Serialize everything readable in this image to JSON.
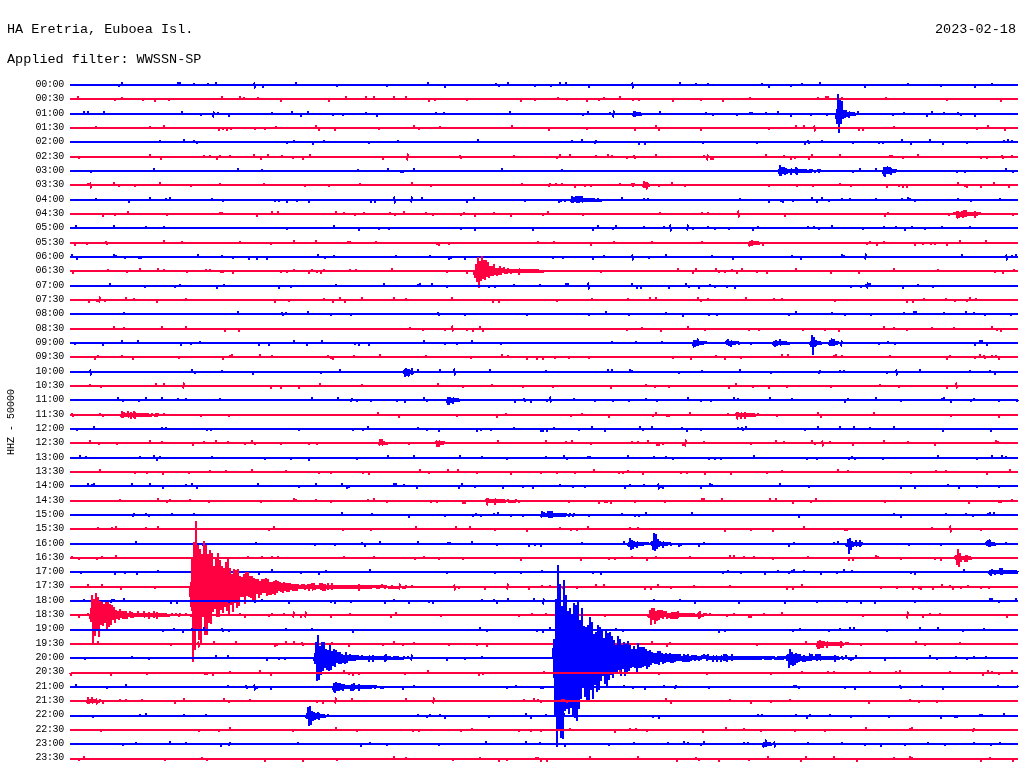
{
  "header": {
    "station": "HA Eretria, Euboea Isl.",
    "date": "2023-02-18"
  },
  "filter": "Applied filter: WWSSN-SP",
  "channel_label": "HHZ - 50000",
  "traces": [
    {
      "time": "00:00",
      "color": "#0000ff"
    },
    {
      "time": "00:30",
      "color": "#ff0040"
    },
    {
      "time": "01:00",
      "color": "#0000ff"
    },
    {
      "time": "01:30",
      "color": "#ff0040"
    },
    {
      "time": "02:00",
      "color": "#0000ff"
    },
    {
      "time": "02:30",
      "color": "#ff0040"
    },
    {
      "time": "03:00",
      "color": "#0000ff"
    },
    {
      "time": "03:30",
      "color": "#ff0040"
    },
    {
      "time": "04:00",
      "color": "#0000ff"
    },
    {
      "time": "04:30",
      "color": "#ff0040"
    },
    {
      "time": "05:00",
      "color": "#0000ff"
    },
    {
      "time": "05:30",
      "color": "#ff0040"
    },
    {
      "time": "06:00",
      "color": "#0000ff"
    },
    {
      "time": "06:30",
      "color": "#ff0040"
    },
    {
      "time": "07:00",
      "color": "#0000ff"
    },
    {
      "time": "07:30",
      "color": "#ff0040"
    },
    {
      "time": "08:00",
      "color": "#0000ff"
    },
    {
      "time": "08:30",
      "color": "#ff0040"
    },
    {
      "time": "09:00",
      "color": "#0000ff"
    },
    {
      "time": "09:30",
      "color": "#ff0040"
    },
    {
      "time": "10:00",
      "color": "#0000ff"
    },
    {
      "time": "10:30",
      "color": "#ff0040"
    },
    {
      "time": "11:00",
      "color": "#0000ff"
    },
    {
      "time": "11:30",
      "color": "#ff0040"
    },
    {
      "time": "12:00",
      "color": "#0000ff"
    },
    {
      "time": "12:30",
      "color": "#ff0040"
    },
    {
      "time": "13:00",
      "color": "#0000ff"
    },
    {
      "time": "13:30",
      "color": "#ff0040"
    },
    {
      "time": "14:00",
      "color": "#0000ff"
    },
    {
      "time": "14:30",
      "color": "#ff0040"
    },
    {
      "time": "15:00",
      "color": "#0000ff"
    },
    {
      "time": "15:30",
      "color": "#ff0040"
    },
    {
      "time": "16:00",
      "color": "#0000ff"
    },
    {
      "time": "16:30",
      "color": "#ff0040"
    },
    {
      "time": "17:00",
      "color": "#0000ff"
    },
    {
      "time": "17:30",
      "color": "#ff0040"
    },
    {
      "time": "18:00",
      "color": "#0000ff"
    },
    {
      "time": "18:30",
      "color": "#ff0040"
    },
    {
      "time": "19:00",
      "color": "#0000ff"
    },
    {
      "time": "19:30",
      "color": "#ff0040"
    },
    {
      "time": "20:00",
      "color": "#0000ff"
    },
    {
      "time": "20:30",
      "color": "#ff0040"
    },
    {
      "time": "21:00",
      "color": "#0000ff"
    },
    {
      "time": "21:30",
      "color": "#ff0040"
    },
    {
      "time": "22:00",
      "color": "#0000ff"
    },
    {
      "time": "22:30",
      "color": "#ff0040"
    },
    {
      "time": "23:00",
      "color": "#0000ff"
    },
    {
      "time": "23:30",
      "color": "#ff0040"
    }
  ]
}
